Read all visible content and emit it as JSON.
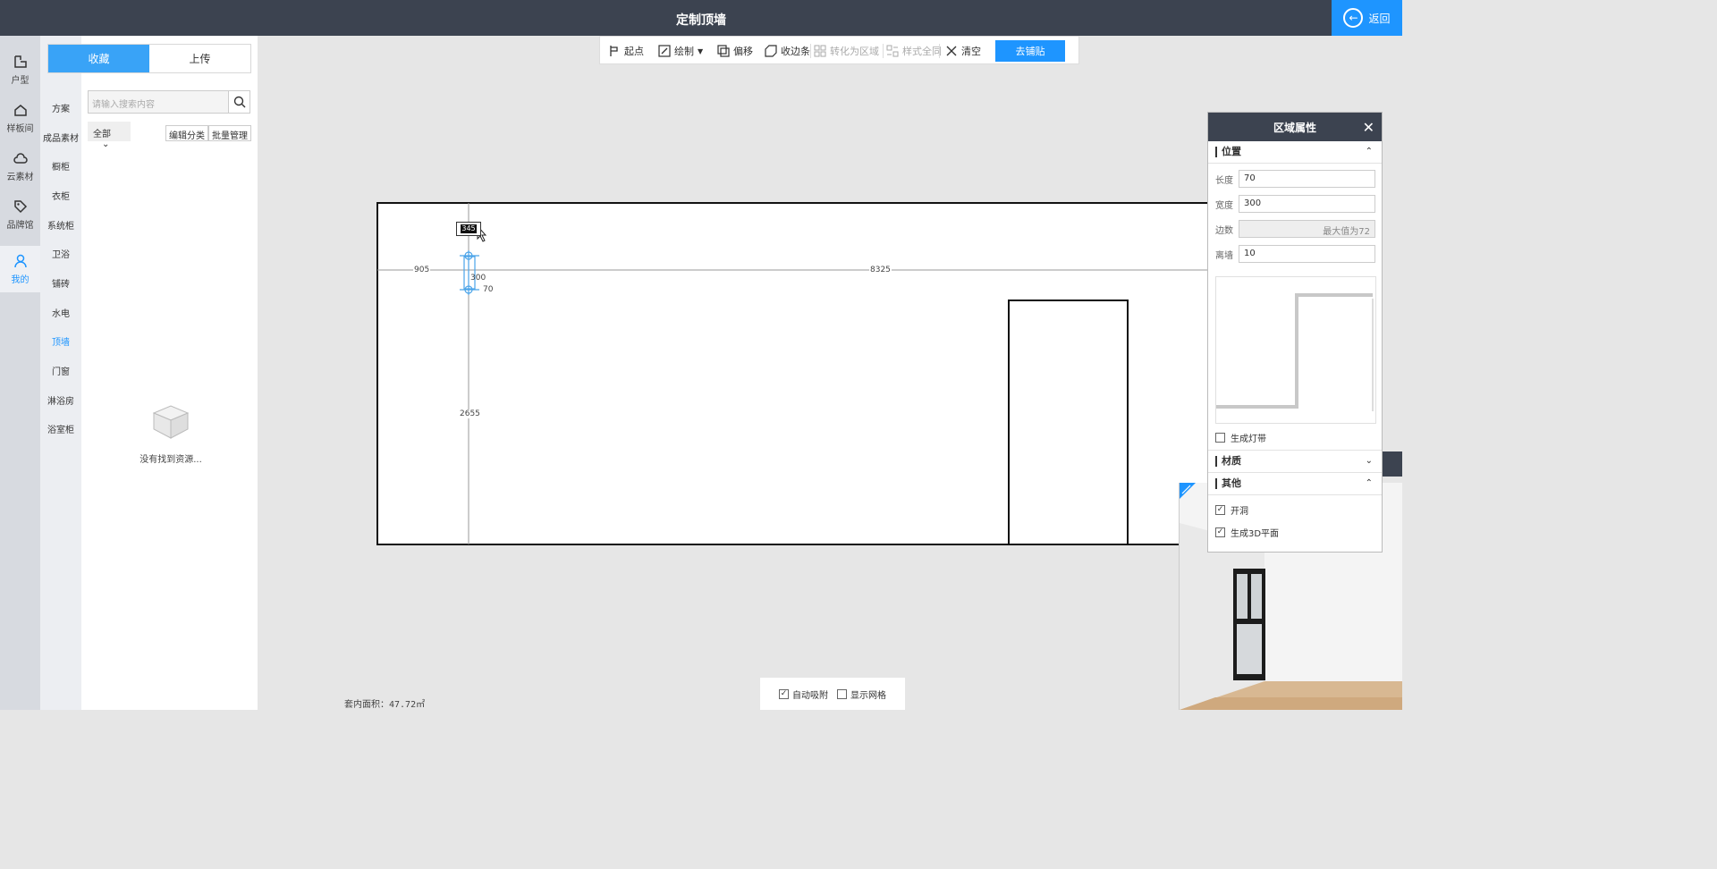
{
  "header": {
    "title": "定制顶墙",
    "back_label": "返回"
  },
  "leftnav": [
    {
      "label": "户型",
      "icon": "floorplan-icon"
    },
    {
      "label": "样板间",
      "icon": "home-icon"
    },
    {
      "label": "云素材",
      "icon": "cloud-icon"
    },
    {
      "label": "品牌馆",
      "icon": "tag-icon"
    },
    {
      "label": "我的",
      "icon": "user-icon",
      "active": true
    }
  ],
  "categories": [
    "方案",
    "成品素材",
    "橱柜",
    "衣柜",
    "系统柜",
    "卫浴",
    "铺砖",
    "水电",
    "顶墙",
    "门窗",
    "淋浴房",
    "浴室柜"
  ],
  "active_category": "顶墙",
  "panel": {
    "tabs": [
      "收藏",
      "上传"
    ],
    "search_placeholder": "请输入搜索内容",
    "filter_value": "全部",
    "edit_category": "编辑分类",
    "batch_manage": "批量管理",
    "empty_text": "没有找到资源..."
  },
  "toolbar": {
    "start": "起点",
    "draw": "绘制",
    "offset": "偏移",
    "trim": "收边条",
    "to_region": "转化为区域",
    "same_style": "样式全同",
    "clear": "清空",
    "apply": "去铺贴"
  },
  "canvas": {
    "dim_left": "905",
    "dim_top": "8325",
    "dim_height": "2655",
    "dim_w": "300",
    "dim_l": "70",
    "tooltip": "345",
    "area_label": "套内面积：47.72㎡"
  },
  "bottom": {
    "auto_snap": "自动吸附",
    "show_grid": "显示网格"
  },
  "props": {
    "title": "区域属性",
    "section_position": "位置",
    "length_label": "长度",
    "length_value": "70",
    "width_label": "宽度",
    "width_value": "300",
    "sides_label": "边数",
    "sides_value": "最大值为72",
    "wall_label": "离墙",
    "wall_value": "10",
    "gen_light": "生成灯带",
    "section_material": "材质",
    "section_other": "其他",
    "open_hole": "开洞",
    "gen_3d": "生成3D平面"
  }
}
